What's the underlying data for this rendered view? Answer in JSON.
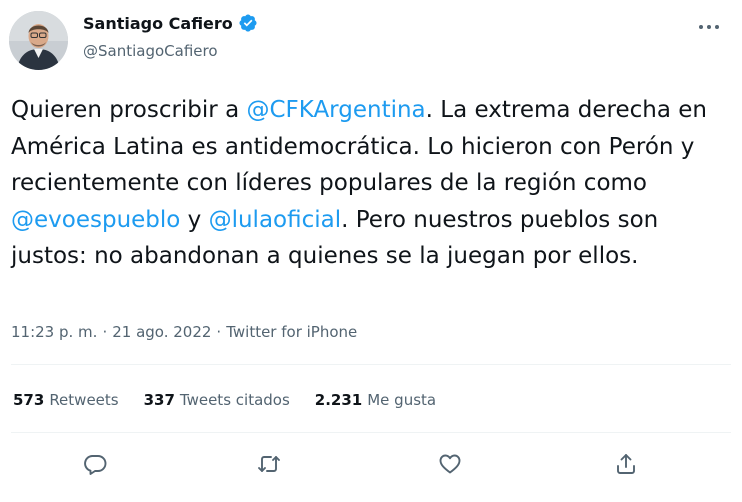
{
  "author": {
    "display_name": "Santiago Cafiero",
    "handle": "@SantiagoCafiero"
  },
  "tweet": {
    "segments": [
      {
        "text": "Quieren proscribir a ",
        "type": "text"
      },
      {
        "text": "@CFKArgentina",
        "type": "mention"
      },
      {
        "text": ". La extrema derecha en América Latina es antidemocrática. Lo hicieron con Perón y recientemente con líderes populares de la región como ",
        "type": "text"
      },
      {
        "text": "@evoespueblo",
        "type": "mention"
      },
      {
        "text": " y ",
        "type": "text"
      },
      {
        "text": "@lulaoficial",
        "type": "mention"
      },
      {
        "text": ". Pero nuestros pueblos son justos: no abandonan a quienes se la juegan por ellos.",
        "type": "text"
      }
    ]
  },
  "meta": {
    "time": "11:23 p. m.",
    "separator": "·",
    "date": "21 ago. 2022",
    "source": "Twitter for iPhone"
  },
  "stats": {
    "retweets_count": "573",
    "retweets_label": "Retweets",
    "quotes_count": "337",
    "quotes_label": "Tweets citados",
    "likes_count": "2.231",
    "likes_label": "Me gusta"
  },
  "actions": {
    "reply_icon": "reply-icon",
    "retweet_icon": "retweet-icon",
    "like_icon": "heart-icon",
    "share_icon": "share-icon"
  },
  "colors": {
    "text": "#0f1419",
    "secondary": "#536471",
    "link": "#1d9bf0",
    "verified": "#1d9bf0",
    "divider": "#eff3f4"
  }
}
